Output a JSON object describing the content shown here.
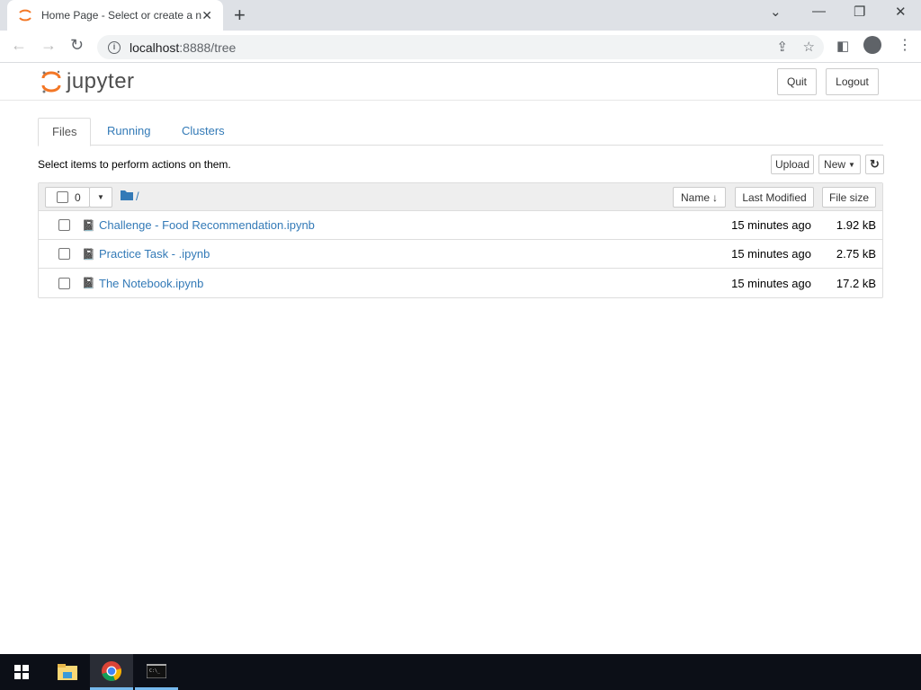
{
  "browser": {
    "tab_title": "Home Page - Select or create a notebook",
    "url_host": "localhost",
    "url_rest": ":8888/tree"
  },
  "header": {
    "logo": "jupyter",
    "quit": "Quit",
    "logout": "Logout"
  },
  "tabs": [
    "Files",
    "Running",
    "Clusters"
  ],
  "hint": "Select items to perform actions on them.",
  "actions": {
    "upload": "Upload",
    "new": "New",
    "refresh_icon": "refresh-icon"
  },
  "list_header": {
    "selected_count": "0",
    "path": "/",
    "sort_name": "Name",
    "last_modified": "Last Modified",
    "file_size": "File size"
  },
  "files": [
    {
      "name": "Challenge - Food Recommendation.ipynb",
      "modified": "15 minutes ago",
      "size": "1.92 kB"
    },
    {
      "name": "Practice Task - .ipynb",
      "modified": "15 minutes ago",
      "size": "2.75 kB"
    },
    {
      "name": "The Notebook.ipynb",
      "modified": "15 minutes ago",
      "size": "17.2 kB"
    }
  ]
}
